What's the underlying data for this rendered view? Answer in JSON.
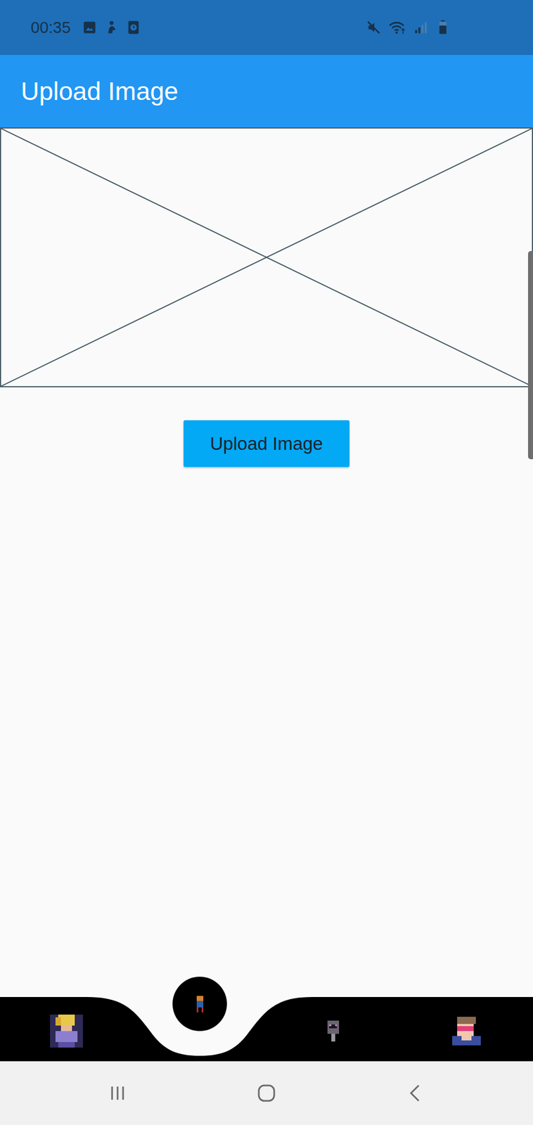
{
  "status_bar": {
    "time": "00:35",
    "battery": {
      "level": 0.7
    }
  },
  "app_bar": {
    "title": "Upload Image"
  },
  "upload_button": {
    "label": "Upload Image"
  },
  "bottom_nav": {
    "items": [
      {
        "selected": false
      },
      {
        "selected": true
      },
      {
        "selected": false
      },
      {
        "selected": false
      }
    ]
  }
}
